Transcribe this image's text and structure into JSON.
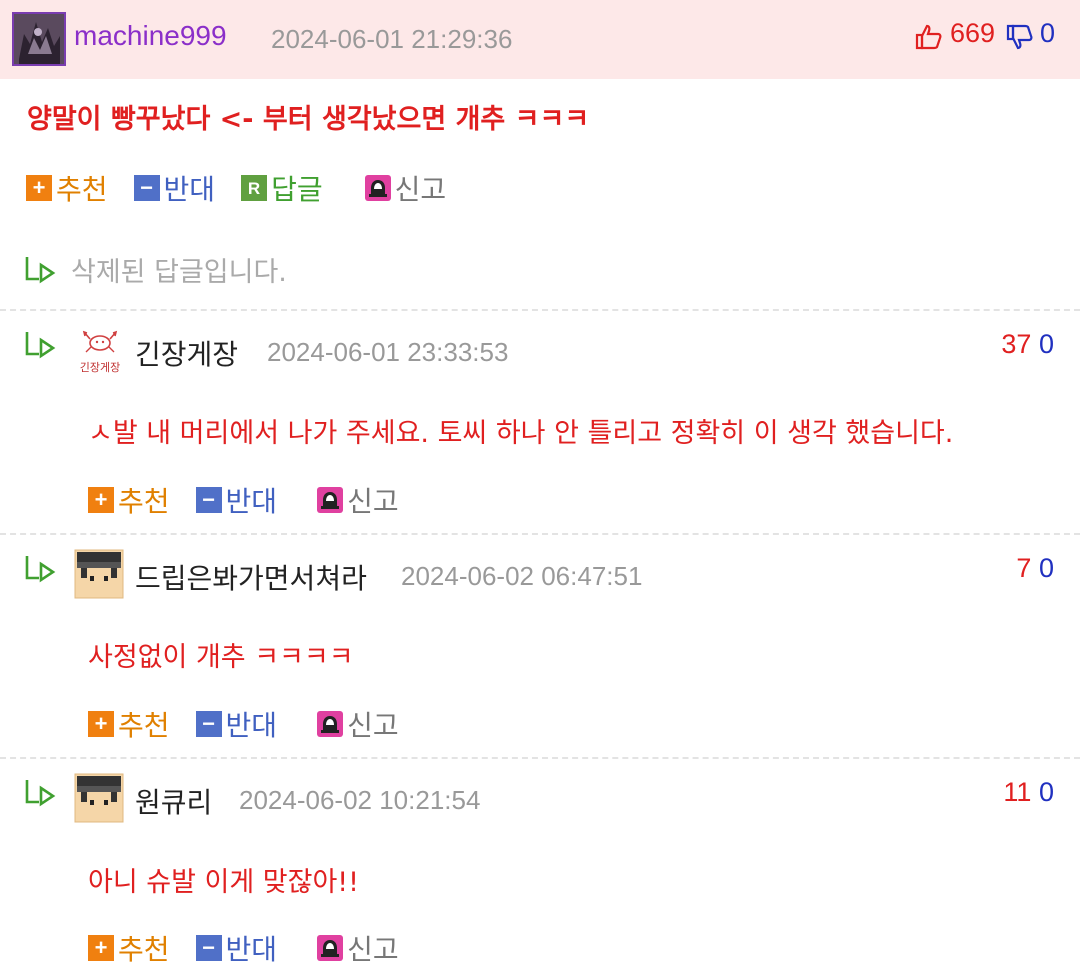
{
  "post": {
    "nick": "machine999",
    "date": "2024-06-01 21:29:36",
    "up_count": "669",
    "down_count": "0",
    "text": "양말이 빵꾸났다 <- 부터 생각났으면 개추 ㅋㅋㅋ",
    "actions": {
      "recommend": "추천",
      "oppose": "반대",
      "reply": "답글",
      "report": "신고"
    },
    "reply_icon_letter": "R"
  },
  "deleted_reply": "삭제된 답글입니다.",
  "replies": [
    {
      "avatar_caption": "긴장게장",
      "nick": "긴장게장",
      "date": "2024-06-01 23:33:53",
      "up": "37",
      "down": "0",
      "text": "ㅅ발 내 머리에서 나가 주세요. 토씨 하나 안 틀리고 정확히 이 생각 했습니다.",
      "actions": {
        "recommend": "추천",
        "oppose": "반대",
        "report": "신고"
      }
    },
    {
      "nick": "드립은봐가면서쳐라",
      "date": "2024-06-02 06:47:51",
      "up": "7",
      "down": "0",
      "text": "사정없이 개추 ㅋㅋㅋㅋ",
      "actions": {
        "recommend": "추천",
        "oppose": "반대",
        "report": "신고"
      }
    },
    {
      "nick": "원큐리",
      "date": "2024-06-02 10:21:54",
      "up": "11",
      "down": "0",
      "text": "아니 슈발 이게 맞잖아!!",
      "actions": {
        "recommend": "추천",
        "oppose": "반대",
        "report": "신고"
      }
    }
  ],
  "colors": {
    "accent_red": "#e02020",
    "down_blue": "#2030c0",
    "header_bg": "#fde8e8"
  }
}
